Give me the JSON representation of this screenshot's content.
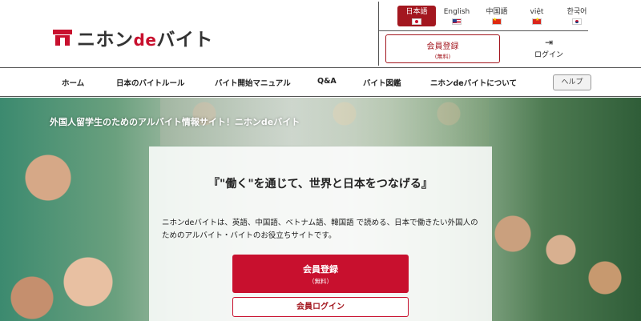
{
  "header": {
    "logo": {
      "prefix": "ニホン",
      "de": "de",
      "suffix": "バイト"
    },
    "languages": [
      {
        "label": "日本語",
        "flag": "jp-flag-icon",
        "active": true
      },
      {
        "label": "English",
        "flag": "us-flag-icon",
        "active": false
      },
      {
        "label": "中国語",
        "flag": "cn-flag-icon",
        "active": false
      },
      {
        "label": "việt",
        "flag": "vn-flag-icon",
        "active": false
      },
      {
        "label": "한국어",
        "flag": "kr-flag-icon",
        "active": false
      }
    ],
    "register": {
      "label": "会員登録",
      "sub": "(無料)"
    },
    "login": {
      "icon": "login-icon",
      "label": "ログイン"
    }
  },
  "nav": {
    "items": [
      "ホーム",
      "日本のバイトルール",
      "バイト開始マニュアル",
      "Q&A",
      "バイト図鑑",
      "ニホンdeバイトについて"
    ],
    "help": "ヘルプ"
  },
  "hero": {
    "caption": "外国人留学生のためのアルバイト情報サイト！ニホンdeバイト",
    "headline": "『\"働く\"を通じて、世界と日本をつなげる』",
    "description": "ニホンdeバイトは、英語、中国語、ベトナム語、韓国語 で読める、日本で働きたい外国人のためのアルバイト・バイトのお役立ちサイトです。",
    "register": {
      "label": "会員登録",
      "sub": "（無料）"
    },
    "login": "会員ログイン"
  },
  "colors": {
    "brand": "#c8102e",
    "brand_dark": "#a3171f"
  }
}
